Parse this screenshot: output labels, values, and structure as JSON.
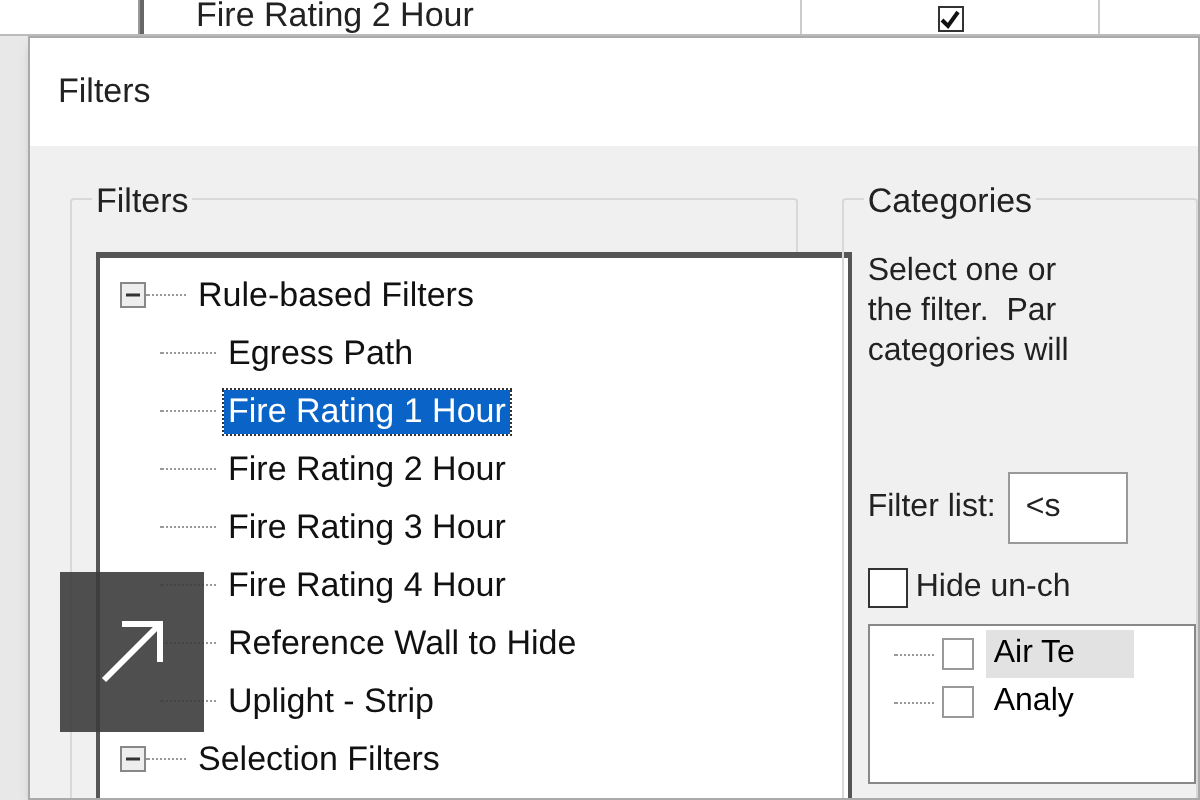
{
  "background_row": {
    "name": "Fire Rating 2 Hour",
    "checked": true
  },
  "window": {
    "title": "Filters"
  },
  "filters_group": {
    "label": "Filters",
    "tree": [
      {
        "label": "Rule-based Filters",
        "selected": false,
        "expanded": true,
        "children": [
          {
            "label": "Egress Path",
            "selected": false
          },
          {
            "label": "Fire Rating 1 Hour",
            "selected": true
          },
          {
            "label": "Fire Rating 2 Hour",
            "selected": false
          },
          {
            "label": "Fire Rating 3 Hour",
            "selected": false
          },
          {
            "label": "Fire Rating 4 Hour",
            "selected": false
          },
          {
            "label": "Reference Wall to Hide",
            "selected": false
          },
          {
            "label": "Uplight - Strip",
            "selected": false
          }
        ]
      },
      {
        "label": "Selection Filters",
        "selected": false,
        "expanded": true
      }
    ]
  },
  "categories_group": {
    "label": "Categories",
    "description": [
      "Select one or",
      "the filter.  Par",
      "categories will"
    ],
    "filter_list": {
      "label": "Filter list:",
      "value": "<s"
    },
    "hide_unchecked": {
      "label": "Hide un-ch",
      "checked": false
    },
    "items": [
      {
        "label": "Air Te",
        "checked": false,
        "highlighted": true
      },
      {
        "label": "Analy",
        "checked": false,
        "highlighted": false
      }
    ]
  }
}
